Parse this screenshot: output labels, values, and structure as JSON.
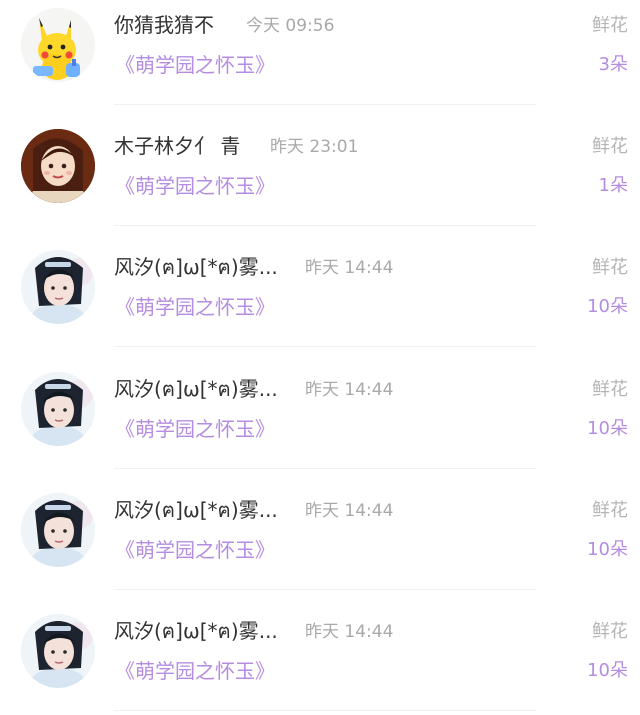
{
  "gift_rows": [
    {
      "avatar": "pikachu-avatar-icon",
      "name": "你猜我猜不",
      "time": "今天 09:56",
      "book": "《萌学园之怀玉》",
      "gift_label": "鲜花",
      "count": "3朵"
    },
    {
      "avatar": "cartoon-girl-avatar-icon",
      "name": "木子林夕亻 青",
      "time": "昨天 23:01",
      "book": "《萌学园之怀玉》",
      "gift_label": "鲜花",
      "count": "1朵"
    },
    {
      "avatar": "costume-character-avatar-icon",
      "name": "风汐(ฅ]ω[*ฅ)雾...",
      "time": "昨天 14:44",
      "book": "《萌学园之怀玉》",
      "gift_label": "鲜花",
      "count": "10朵"
    },
    {
      "avatar": "costume-character-avatar-icon",
      "name": "风汐(ฅ]ω[*ฅ)雾...",
      "time": "昨天 14:44",
      "book": "《萌学园之怀玉》",
      "gift_label": "鲜花",
      "count": "10朵"
    },
    {
      "avatar": "costume-character-avatar-icon",
      "name": "风汐(ฅ]ω[*ฅ)雾...",
      "time": "昨天 14:44",
      "book": "《萌学园之怀玉》",
      "gift_label": "鲜花",
      "count": "10朵"
    },
    {
      "avatar": "costume-character-avatar-icon",
      "name": "风汐(ฅ]ω[*ฅ)雾...",
      "time": "昨天 14:44",
      "book": "《萌学园之怀玉》",
      "gift_label": "鲜花",
      "count": "10朵"
    }
  ],
  "colors": {
    "accent_purple": "#b58de0",
    "name_text": "#333333",
    "muted_text": "#a9a9a9",
    "divider": "#f1f1f1"
  }
}
